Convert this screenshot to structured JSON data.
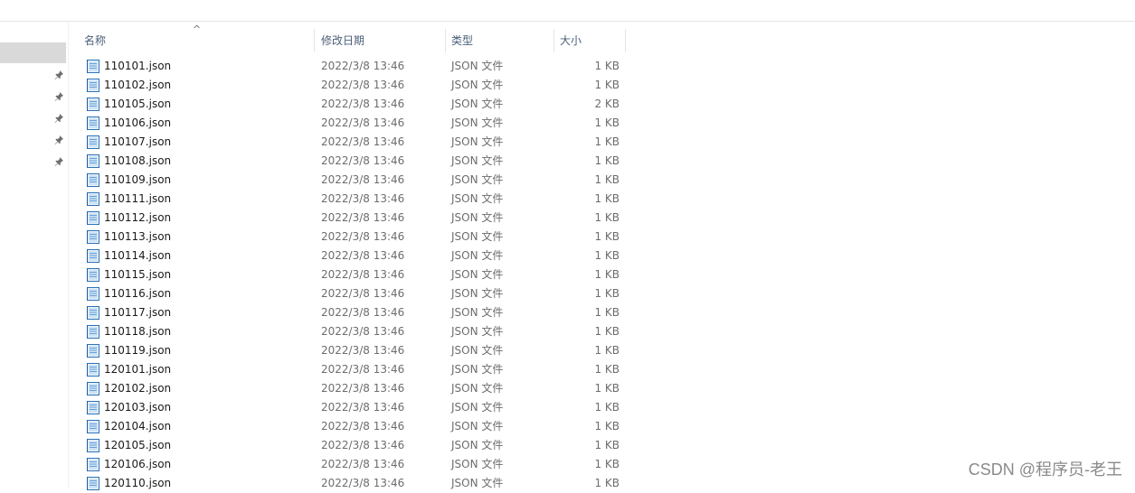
{
  "columns": {
    "name": "名称",
    "date": "修改日期",
    "type": "类型",
    "size": "大小"
  },
  "sort_indicator": "^",
  "icons": {
    "file": "json-file-icon",
    "pin": "pin-icon"
  },
  "files": [
    {
      "name": "110101.json",
      "date": "2022/3/8 13:46",
      "type": "JSON 文件",
      "size": "1 KB"
    },
    {
      "name": "110102.json",
      "date": "2022/3/8 13:46",
      "type": "JSON 文件",
      "size": "1 KB"
    },
    {
      "name": "110105.json",
      "date": "2022/3/8 13:46",
      "type": "JSON 文件",
      "size": "2 KB"
    },
    {
      "name": "110106.json",
      "date": "2022/3/8 13:46",
      "type": "JSON 文件",
      "size": "1 KB"
    },
    {
      "name": "110107.json",
      "date": "2022/3/8 13:46",
      "type": "JSON 文件",
      "size": "1 KB"
    },
    {
      "name": "110108.json",
      "date": "2022/3/8 13:46",
      "type": "JSON 文件",
      "size": "1 KB"
    },
    {
      "name": "110109.json",
      "date": "2022/3/8 13:46",
      "type": "JSON 文件",
      "size": "1 KB"
    },
    {
      "name": "110111.json",
      "date": "2022/3/8 13:46",
      "type": "JSON 文件",
      "size": "1 KB"
    },
    {
      "name": "110112.json",
      "date": "2022/3/8 13:46",
      "type": "JSON 文件",
      "size": "1 KB"
    },
    {
      "name": "110113.json",
      "date": "2022/3/8 13:46",
      "type": "JSON 文件",
      "size": "1 KB"
    },
    {
      "name": "110114.json",
      "date": "2022/3/8 13:46",
      "type": "JSON 文件",
      "size": "1 KB"
    },
    {
      "name": "110115.json",
      "date": "2022/3/8 13:46",
      "type": "JSON 文件",
      "size": "1 KB"
    },
    {
      "name": "110116.json",
      "date": "2022/3/8 13:46",
      "type": "JSON 文件",
      "size": "1 KB"
    },
    {
      "name": "110117.json",
      "date": "2022/3/8 13:46",
      "type": "JSON 文件",
      "size": "1 KB"
    },
    {
      "name": "110118.json",
      "date": "2022/3/8 13:46",
      "type": "JSON 文件",
      "size": "1 KB"
    },
    {
      "name": "110119.json",
      "date": "2022/3/8 13:46",
      "type": "JSON 文件",
      "size": "1 KB"
    },
    {
      "name": "120101.json",
      "date": "2022/3/8 13:46",
      "type": "JSON 文件",
      "size": "1 KB"
    },
    {
      "name": "120102.json",
      "date": "2022/3/8 13:46",
      "type": "JSON 文件",
      "size": "1 KB"
    },
    {
      "name": "120103.json",
      "date": "2022/3/8 13:46",
      "type": "JSON 文件",
      "size": "1 KB"
    },
    {
      "name": "120104.json",
      "date": "2022/3/8 13:46",
      "type": "JSON 文件",
      "size": "1 KB"
    },
    {
      "name": "120105.json",
      "date": "2022/3/8 13:46",
      "type": "JSON 文件",
      "size": "1 KB"
    },
    {
      "name": "120106.json",
      "date": "2022/3/8 13:46",
      "type": "JSON 文件",
      "size": "1 KB"
    },
    {
      "name": "120110.json",
      "date": "2022/3/8 13:46",
      "type": "JSON 文件",
      "size": "1 KB"
    }
  ],
  "watermark": "CSDN @程序员-老王"
}
